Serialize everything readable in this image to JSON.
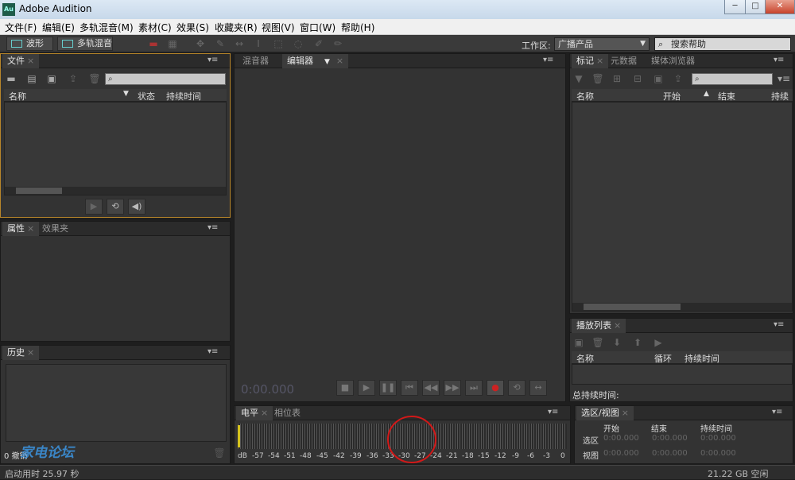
{
  "window": {
    "title": "Adobe Audition",
    "app_icon": "Au"
  },
  "menu": [
    "文件(F)",
    "编辑(E)",
    "多轨混音(M)",
    "素材(C)",
    "效果(S)",
    "收藏夹(R)",
    "视图(V)",
    "窗口(W)",
    "帮助(H)"
  ],
  "toolbar": {
    "waveform": "波形",
    "multitrack": "多轨混音",
    "workspace_label": "工作区:",
    "workspace_value": "广播产品",
    "help_search": "搜索帮助"
  },
  "files_panel": {
    "tab": "文件",
    "columns": [
      "名称",
      "状态",
      "持续时间"
    ]
  },
  "props_panel": {
    "tabs": [
      "属性",
      "效果夹"
    ]
  },
  "history_panel": {
    "tab": "历史",
    "undo_count": "0 撤销"
  },
  "editor_panel": {
    "tabs": [
      "混音器",
      "编辑器"
    ],
    "time": "0:00.000"
  },
  "markers_panel": {
    "tabs": [
      "标记",
      "元数据",
      "媒体浏览器"
    ],
    "columns": [
      "名称",
      "开始",
      "结束",
      "持续时"
    ]
  },
  "playlist_panel": {
    "tab": "播放列表",
    "columns": [
      "名称",
      "循环",
      "持续时间"
    ],
    "total_label": "总持续时间:"
  },
  "level_panel": {
    "tabs": [
      "电平",
      "相位表"
    ],
    "scale": [
      "dB",
      "-57",
      "-54",
      "-51",
      "-48",
      "-45",
      "-42",
      "-39",
      "-36",
      "-33",
      "-30",
      "-27",
      "-24",
      "-21",
      "-18",
      "-15",
      "-12",
      "-9",
      "-6",
      "-3",
      "0"
    ]
  },
  "selection_panel": {
    "tab": "选区/视图",
    "cols": [
      "开始",
      "结束",
      "持续时间"
    ],
    "rows": [
      {
        "label": "选区",
        "start": "0:00.000",
        "end": "0:00.000",
        "dur": "0:00.000"
      },
      {
        "label": "视图",
        "start": "0:00.000",
        "end": "0:00.000",
        "dur": "0:00.000"
      }
    ]
  },
  "watermark": "家电论坛",
  "status": {
    "left": "启动用时 25.97 秒",
    "right": "21.22 GB 空闲"
  }
}
